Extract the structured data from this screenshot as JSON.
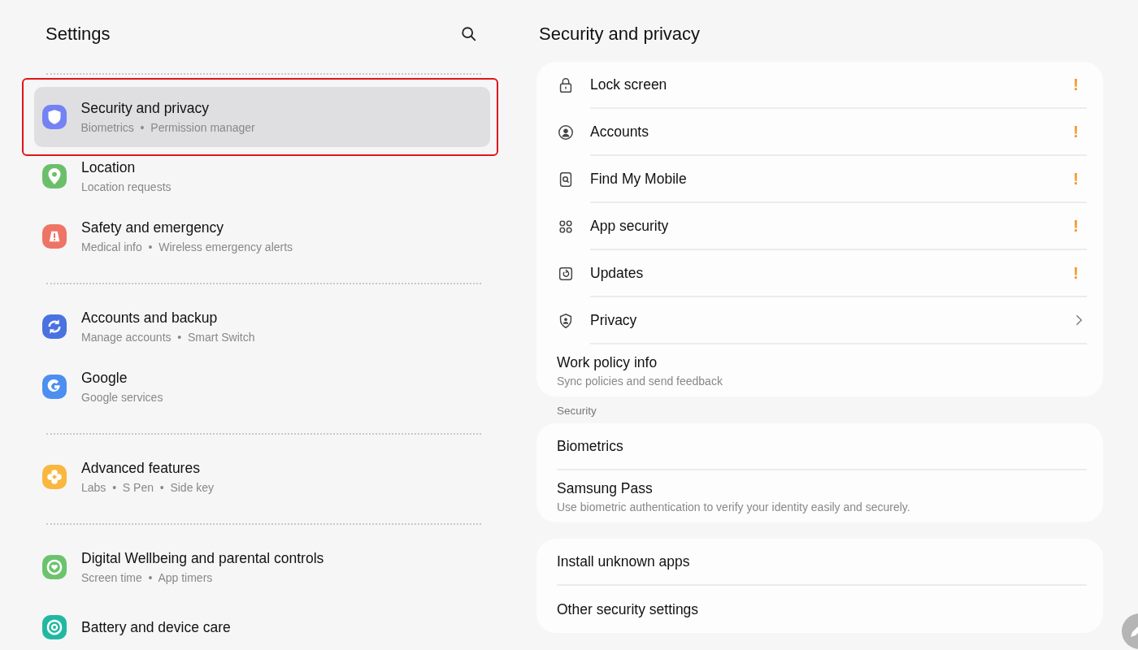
{
  "sidebar": {
    "title": "Settings",
    "groups": [
      {
        "items": [
          {
            "title": "Security and privacy",
            "subtitle": "Biometrics  •  Permission manager",
            "color": "#7482f4",
            "selected": true,
            "highlighted": true
          },
          {
            "title": "Location",
            "subtitle": "Location requests",
            "color": "#6cbf6a",
            "selected": false,
            "highlighted": false
          },
          {
            "title": "Safety and emergency",
            "subtitle": "Medical info  •  Wireless emergency alerts",
            "color": "#ee7466",
            "selected": false,
            "highlighted": false
          }
        ]
      },
      {
        "items": [
          {
            "title": "Accounts and backup",
            "subtitle": "Manage accounts  •  Smart Switch",
            "color": "#4a73e0",
            "selected": false,
            "highlighted": false
          },
          {
            "title": "Google",
            "subtitle": "Google services",
            "color": "#4d8ff0",
            "selected": false,
            "highlighted": false
          }
        ]
      },
      {
        "items": [
          {
            "title": "Advanced features",
            "subtitle": "Labs  •  S Pen  •  Side key",
            "color": "#f9b740",
            "selected": false,
            "highlighted": false
          }
        ]
      },
      {
        "items": [
          {
            "title": "Digital Wellbeing and parental controls",
            "subtitle": "Screen time  •  App timers",
            "color": "#6cc36e",
            "selected": false,
            "highlighted": false
          },
          {
            "title": "Battery and device care",
            "color": "#21b8a2",
            "selected": false,
            "highlighted": false
          }
        ]
      }
    ]
  },
  "detail": {
    "title": "Security and privacy",
    "cards": [
      {
        "rows": [
          {
            "title": "Lock screen",
            "badge": "!",
            "chevron": false
          },
          {
            "title": "Accounts",
            "badge": "!",
            "chevron": false
          },
          {
            "title": "Find My Mobile",
            "badge": "!",
            "chevron": false
          },
          {
            "title": "App security",
            "badge": "!",
            "chevron": false
          },
          {
            "title": "Updates",
            "badge": "!",
            "chevron": false
          },
          {
            "title": "Privacy",
            "chevron": true
          },
          {
            "title": "Work policy info",
            "subtitle": "Sync policies and send feedback",
            "chevron": false
          }
        ]
      },
      {
        "header": "Security",
        "rows": [
          {
            "title": "Biometrics",
            "chevron": false
          },
          {
            "title": "Samsung Pass",
            "subtitle": "Use biometric authentication to verify your identity easily and securely.",
            "chevron": false
          }
        ]
      },
      {
        "rows": [
          {
            "title": "Install unknown apps",
            "chevron": false
          },
          {
            "title": "Other security settings",
            "chevron": false
          }
        ]
      }
    ]
  }
}
